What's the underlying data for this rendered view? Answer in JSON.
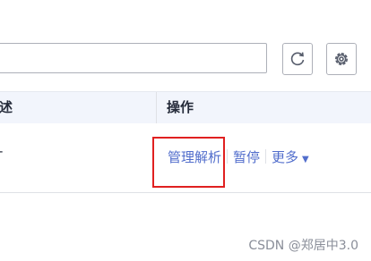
{
  "toolbar": {
    "search_value": "",
    "refresh_icon": "refresh-icon",
    "settings_icon": "gear-icon"
  },
  "table": {
    "columns": [
      "描述",
      "操作"
    ],
    "rows": [
      {
        "description": "-",
        "actions": [
          "管理解析",
          "暂停",
          "更多"
        ]
      }
    ]
  },
  "colors": {
    "link": "#526ecc",
    "header_bg": "#f2f5fc",
    "highlight": "#e02020"
  },
  "watermark": "CSDN @郑居中3.0"
}
